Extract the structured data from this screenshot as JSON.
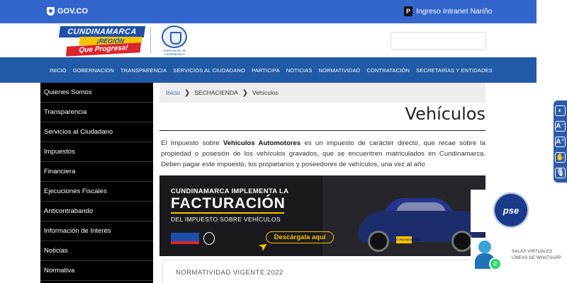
{
  "topbar": {
    "gov_label": "GOV.CO",
    "intranet_label": "Ingreso Intranet Nariño",
    "intranet_icon": "P"
  },
  "header": {
    "logo": {
      "line1": "CUNDINAMARCA",
      "line2": "¡REGIÓN",
      "line3": "Que Progresa!"
    },
    "seal_caption": "Gobernación de Cundinamarca",
    "search_placeholder": ""
  },
  "nav": {
    "items": [
      "INICIO",
      "GOBERNACION",
      "TRANSPARENCIA",
      "SERVICIOS AL CIUDADANO",
      "PARTICIPA",
      "NOTICIAS",
      "NORMATIVIDAD",
      "CONTRATACIÓN",
      "SECRETARÍAS Y ENTIDADES"
    ]
  },
  "sidebar": {
    "items": [
      "Quienes Somos",
      "Transparencia",
      "Servicios al Ciudadano",
      "Impuestos",
      "Financiera",
      "Ejecuciones Fiscales",
      "Anticontrabando",
      "Información de Interés",
      "Noticias",
      "Normativa"
    ]
  },
  "breadcrumb": {
    "home": "Inicio",
    "level1": "SECHACIENDA",
    "level2": "Vehículos",
    "separator": "❯"
  },
  "page": {
    "title": "Vehículos",
    "intro_before": "El Impuesto sobre ",
    "intro_bold": "Vehículos Automotores",
    "intro_after": " es un impuesto de carácter directo, que recae sobre la propiedad o posesión de los vehículos gravados, que se encuentren matriculados en Cundinamarca. Deben pagar este impuesto, los propietarios y poseedores de vehículos, una vez al año"
  },
  "banner": {
    "line1": "CUNDINAMARCA IMPLEMENTA LA",
    "line2": "FACTURACIÓN",
    "line3": "DEL IMPUESTO SOBRE VEHÍCULOS",
    "cta": "Descárgala aquí",
    "plate": "CUNDINAMARCA"
  },
  "normatividad": {
    "label": "NORMATIVIDAD VIGENTE 2022"
  },
  "accessibility": {
    "buttons": [
      "◐",
      "A⁻",
      "A⁺",
      "✋",
      "🎙"
    ]
  },
  "floating": {
    "pse_label": "pse",
    "whatsapp_line1": "SALAS VIRTUALES",
    "whatsapp_line2": "LÍNEAS DE WHATSAPP"
  },
  "colors": {
    "gov_bar": "#3366cc",
    "nav_bar": "#215aa6",
    "sidebar": "#000000",
    "accent_yellow": "#f6c400"
  }
}
